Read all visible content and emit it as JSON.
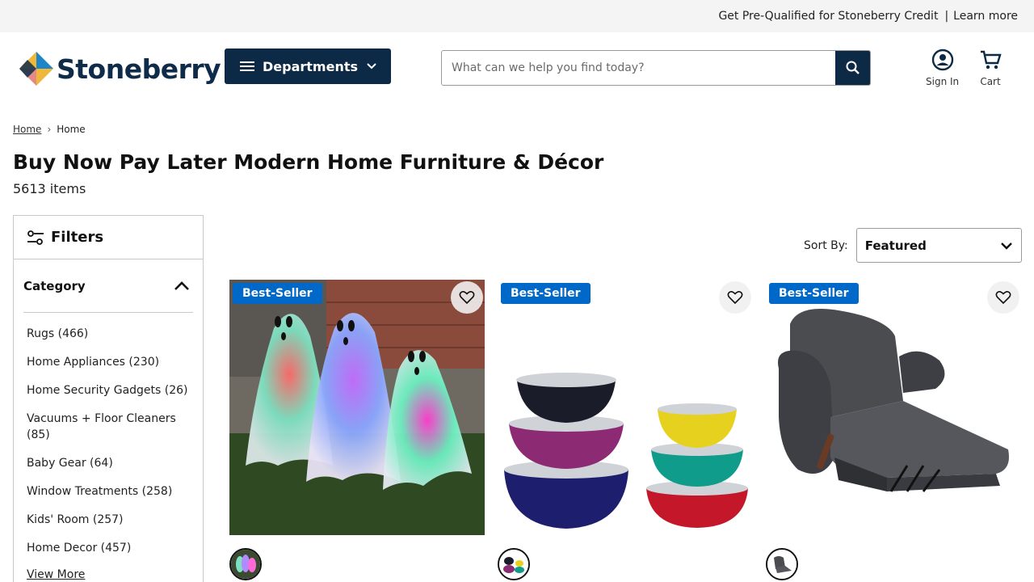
{
  "promo": {
    "text": "Get Pre-Qualified for Stoneberry Credit",
    "separator": "|",
    "link": "Learn more"
  },
  "logo": {
    "text": "Stoneberry"
  },
  "nav": {
    "departments_label": "Departments"
  },
  "search": {
    "placeholder": "What can we help you find today?"
  },
  "header_actions": {
    "sign_in": "Sign In",
    "cart": "Cart"
  },
  "breadcrumb": [
    {
      "label": "Home"
    },
    {
      "label": "Home"
    }
  ],
  "page": {
    "title": "Buy Now Pay Later Modern Home Furniture & Décor",
    "item_count": "5613 items"
  },
  "filters": {
    "title": "Filters",
    "category_title": "Category",
    "categories": [
      "Rugs (466)",
      "Home Appliances (230)",
      "Home Security Gadgets (26)",
      "Vacuums + Floor Cleaners (85)",
      "Baby Gear (64)",
      "Window Treatments (258)",
      "Kids' Room (257)",
      "Home Decor (457)"
    ],
    "view_more": "View More"
  },
  "sort": {
    "label": "Sort By:",
    "selected": "Featured"
  },
  "products": [
    {
      "badge": "Best-Seller",
      "image": "light-up-ghosts"
    },
    {
      "badge": "Best-Seller",
      "image": "mixing-bowls-set"
    },
    {
      "badge": "Best-Seller",
      "image": "gray-recliner"
    }
  ],
  "colors": {
    "navy": "#0c2a46",
    "badge_blue": "#0068c8",
    "promo_bg": "#f4f4f4"
  }
}
